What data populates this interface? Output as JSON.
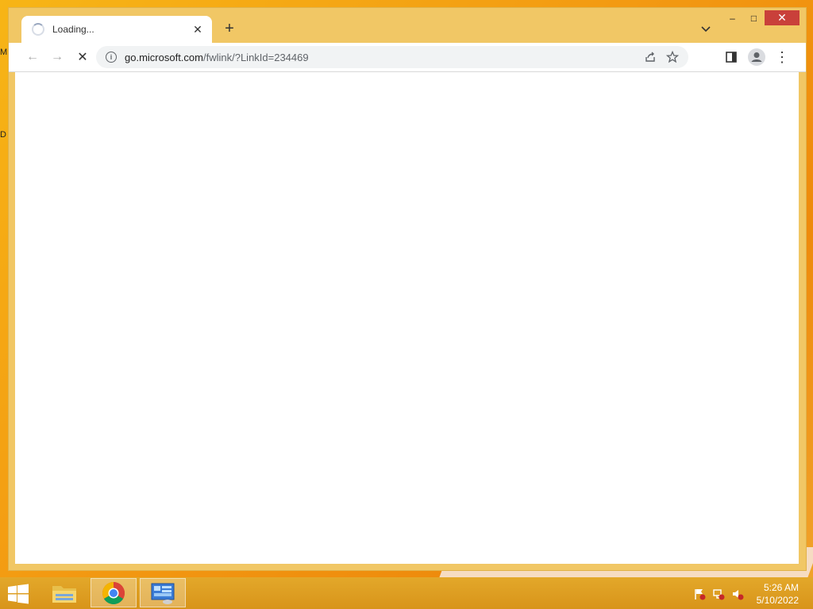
{
  "desktop": {
    "edge_label_top": "M",
    "edge_label_mid": "D"
  },
  "window": {
    "caption": {
      "minimize_glyph": "–",
      "maximize_glyph": "□",
      "close_glyph": "✕"
    },
    "tab": {
      "title": "Loading...",
      "close_glyph": "✕",
      "new_tab_glyph": "+"
    },
    "toolbar": {
      "back_glyph": "←",
      "forward_glyph": "→",
      "stop_glyph": "✕",
      "url_host": "go.microsoft.com",
      "url_path": "/fwlink/?LinkId=234469",
      "menu_glyph": "⋮"
    }
  },
  "taskbar": {
    "apps": [
      {
        "name": "file-explorer",
        "active": false
      },
      {
        "name": "chrome",
        "active": true
      },
      {
        "name": "control-panel",
        "active": true
      }
    ],
    "clock": {
      "time": "5:26 AM",
      "date": "5/10/2022"
    }
  },
  "colors": {
    "window_frame": "#f1c765",
    "close_button": "#c9403a",
    "desktop": "#f39a12",
    "taskbar": "#d8941a"
  }
}
